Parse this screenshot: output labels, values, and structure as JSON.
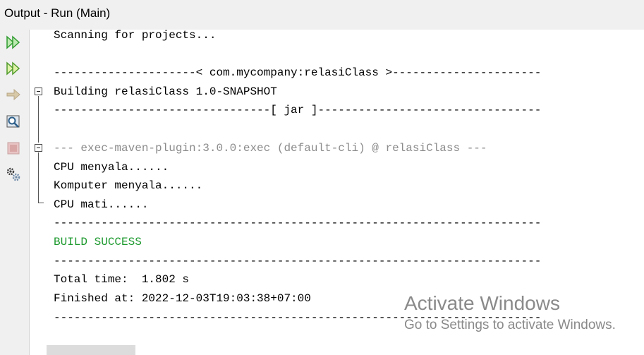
{
  "window": {
    "title": "Output - Run (Main)"
  },
  "toolbar": {
    "buttons": [
      {
        "name": "rerun-icon",
        "tooltip": "Re-run"
      },
      {
        "name": "rerun-goals-icon",
        "tooltip": "Re-run with different parameters"
      },
      {
        "name": "resume-icon",
        "tooltip": "Resume"
      },
      {
        "name": "show-output-icon",
        "tooltip": "Show output"
      },
      {
        "name": "stop-icon",
        "tooltip": "Stop"
      },
      {
        "name": "settings-icon",
        "tooltip": "Settings"
      }
    ]
  },
  "output": {
    "lines": [
      {
        "text": "Scanning for projects...",
        "style": "normal"
      },
      {
        "text": "",
        "style": "normal"
      },
      {
        "text": "---------------------< com.mycompany:relasiClass >----------------------",
        "style": "normal"
      },
      {
        "text": "Building relasiClass 1.0-SNAPSHOT",
        "style": "normal"
      },
      {
        "text": "--------------------------------[ jar ]---------------------------------",
        "style": "normal"
      },
      {
        "text": "",
        "style": "normal"
      },
      {
        "text": "--- exec-maven-plugin:3.0.0:exec (default-cli) @ relasiClass ---",
        "style": "gray"
      },
      {
        "text": "CPU menyala......",
        "style": "normal"
      },
      {
        "text": "Komputer menyala......",
        "style": "normal"
      },
      {
        "text": "CPU mati......",
        "style": "normal"
      },
      {
        "text": "------------------------------------------------------------------------",
        "style": "normal"
      },
      {
        "text": "BUILD SUCCESS",
        "style": "green"
      },
      {
        "text": "------------------------------------------------------------------------",
        "style": "normal"
      },
      {
        "text": "Total time:  1.802 s",
        "style": "normal"
      },
      {
        "text": "Finished at: 2022-12-03T19:03:38+07:00",
        "style": "normal"
      },
      {
        "text": "------------------------------------------------------------------------",
        "style": "normal"
      }
    ]
  },
  "watermark": {
    "line1": "Activate Windows",
    "line2": "Go to Settings to activate Windows."
  },
  "colors": {
    "success_green": "#1e9a2f",
    "plugin_gray": "#8c8c8c",
    "rerun_green": "#3aa53a"
  }
}
